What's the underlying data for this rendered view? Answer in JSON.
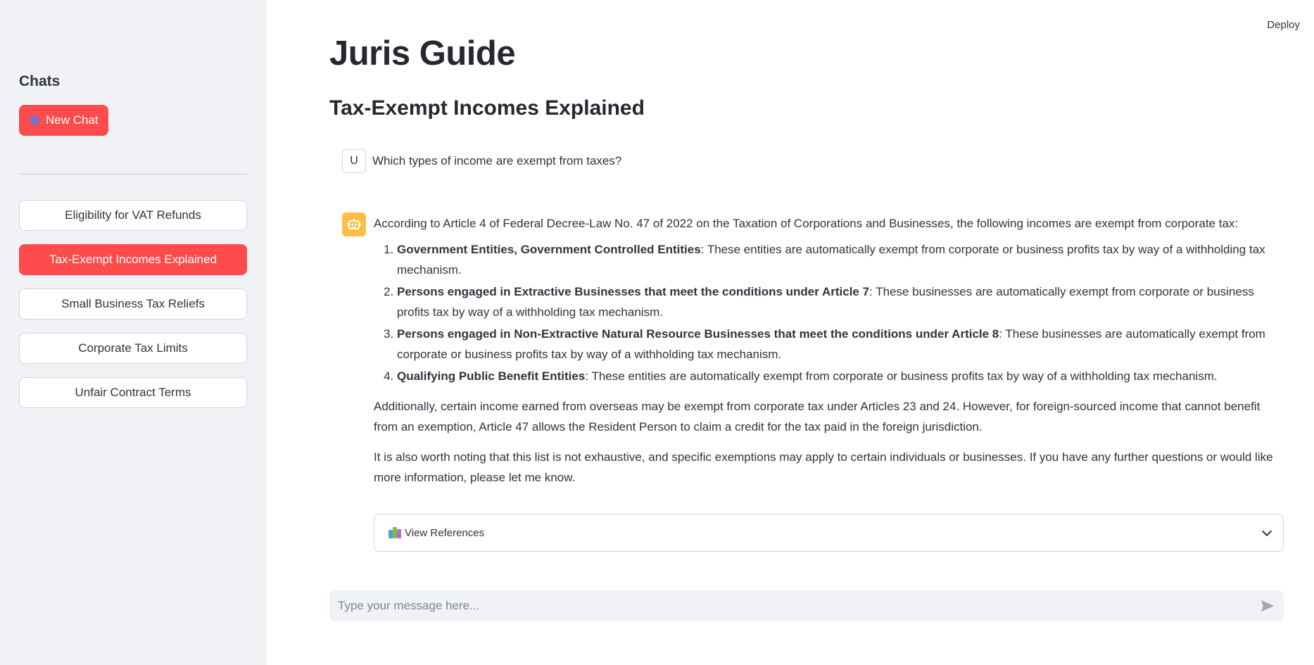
{
  "header": {
    "deploy_label": "Deploy"
  },
  "sidebar": {
    "heading": "Chats",
    "new_chat_label": "New Chat",
    "items": [
      {
        "label": "Eligibility for VAT Refunds",
        "active": false
      },
      {
        "label": "Tax-Exempt Incomes Explained",
        "active": true
      },
      {
        "label": "Small Business Tax Reliefs",
        "active": false
      },
      {
        "label": "Corporate Tax Limits",
        "active": false
      },
      {
        "label": "Unfair Contract Terms",
        "active": false
      }
    ]
  },
  "main": {
    "app_title": "Juris Guide",
    "chat_title": "Tax-Exempt Incomes Explained",
    "user_message": {
      "avatar_letter": "U",
      "text": "Which types of income are exempt from taxes?"
    },
    "assistant_message": {
      "intro": "According to Article 4 of Federal Decree-Law No. 47 of 2022 on the Taxation of Corporations and Businesses, the following incomes are exempt from corporate tax:",
      "list": [
        {
          "bold": "Government Entities, Government Controlled Entities",
          "text": ": These entities are automatically exempt from corporate or business profits tax by way of a withholding tax mechanism."
        },
        {
          "bold": "Persons engaged in Extractive Businesses that meet the conditions under Article 7",
          "text": ": These businesses are automatically exempt from corporate or business profits tax by way of a withholding tax mechanism."
        },
        {
          "bold": "Persons engaged in Non-Extractive Natural Resource Businesses that meet the conditions under Article 8",
          "text": ": These businesses are automatically exempt from corporate or business profits tax by way of a withholding tax mechanism."
        },
        {
          "bold": "Qualifying Public Benefit Entities",
          "text": ": These entities are automatically exempt from corporate or business profits tax by way of a withholding tax mechanism."
        }
      ],
      "para1": "Additionally, certain income earned from overseas may be exempt from corporate tax under Articles 23 and 24. However, for foreign-sourced income that cannot benefit from an exemption, Article 47 allows the Resident Person to claim a credit for the tax paid in the foreign jurisdiction.",
      "para2": "It is also worth noting that this list is not exhaustive, and specific exemptions may apply to certain individuals or businesses. If you have any further questions or would like more information, please let me know.",
      "references_label": "View References"
    },
    "input": {
      "placeholder": "Type your message here..."
    }
  },
  "colors": {
    "accent": "#ff4b4b",
    "sidebar_bg": "#f0f2f6",
    "bot_avatar": "#ffbd45",
    "plus_icon": "#4f7cff"
  },
  "icons": [
    "plus-icon",
    "robot-icon",
    "books-icon",
    "chevron-down-icon",
    "send-icon"
  ]
}
